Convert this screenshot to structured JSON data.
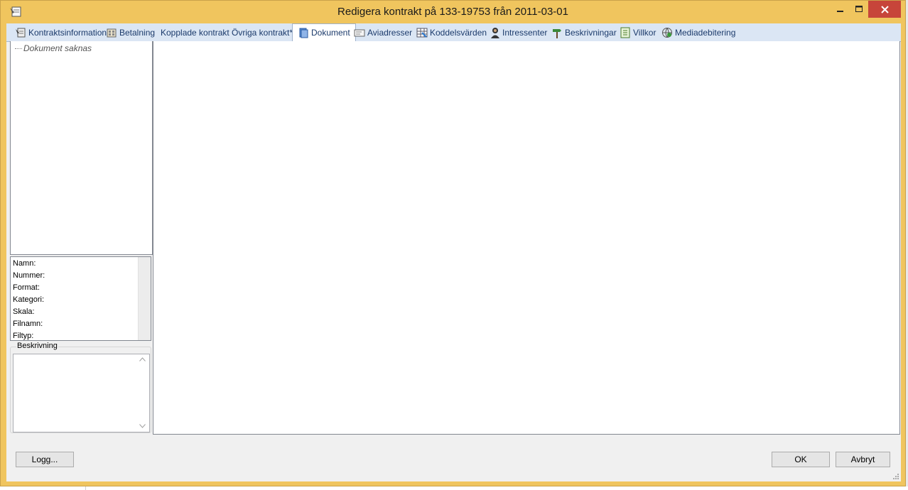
{
  "window": {
    "title": "Redigera kontrakt på 133-19753 från 2011-03-01"
  },
  "tabs": [
    {
      "label": "Kontraktsinformation",
      "icon": "contract-info-icon"
    },
    {
      "label": "Betalning",
      "icon": "payment-icon"
    },
    {
      "label": "Kopplade kontrakt",
      "icon": ""
    },
    {
      "label": "Övriga kontrakt*",
      "icon": ""
    },
    {
      "label": "Dokument",
      "icon": "document-icon",
      "active": true
    },
    {
      "label": "Aviadresser",
      "icon": "address-card-icon"
    },
    {
      "label": "Koddelsvärden",
      "icon": "grid-table-icon"
    },
    {
      "label": "Intressenter",
      "icon": "person-icon"
    },
    {
      "label": "Beskrivningar",
      "icon": "signpost-icon"
    },
    {
      "label": "Villkor",
      "icon": "checklist-icon"
    },
    {
      "label": "Mediadebitering",
      "icon": "globe-media-icon"
    }
  ],
  "tree": {
    "empty_text": "Dokument saknas"
  },
  "properties": {
    "fields": [
      "Namn:",
      "Nummer:",
      "Format:",
      "Kategori:",
      "Skala:",
      "Filnamn:",
      "Filtyp:"
    ]
  },
  "description": {
    "legend": "Beskrivning",
    "value": ""
  },
  "buttons": {
    "log": "Logg...",
    "ok": "OK",
    "cancel": "Avbryt"
  },
  "colors": {
    "window_frame": "#f0c55e",
    "close_button": "#c7453a",
    "tab_bar": "#dbe6f4"
  }
}
